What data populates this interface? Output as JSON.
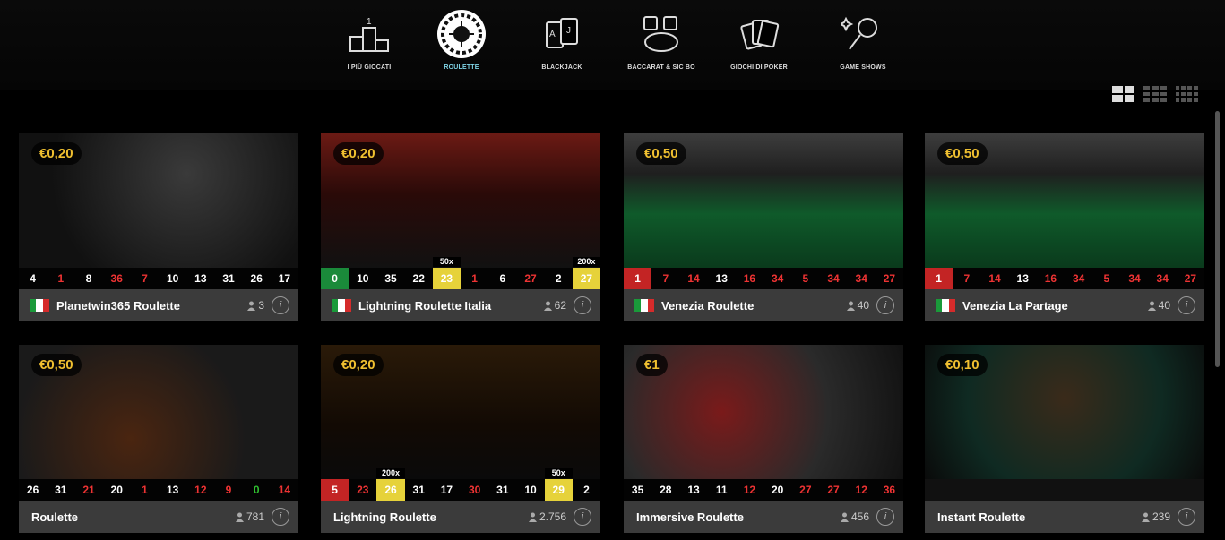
{
  "categories": [
    {
      "label": "I PIÙ GIOCATI",
      "icon": "podium-icon"
    },
    {
      "label": "ROULETTE",
      "icon": "roulette-wheel-icon",
      "active": true
    },
    {
      "label": "BLACKJACK",
      "icon": "cards-aj-icon"
    },
    {
      "label": "BACCARAT & SIC BO",
      "icon": "dice-cards-icon"
    },
    {
      "label": "GIOCHI DI POKER",
      "icon": "poker-cards-icon"
    },
    {
      "label": "GAME SHOWS",
      "icon": "microphone-icon"
    }
  ],
  "view_toggles": [
    "grid-2-icon",
    "grid-3-icon",
    "grid-4-icon"
  ],
  "tiles": [
    {
      "bet": "€0,20",
      "name": "Planetwin365 Roulette",
      "flag": true,
      "players": "3",
      "results": [
        [
          "4",
          "b"
        ],
        [
          "1",
          "r"
        ],
        [
          "8",
          "b"
        ],
        [
          "36",
          "r"
        ],
        [
          "7",
          "r"
        ],
        [
          "10",
          "b"
        ],
        [
          "13",
          "b"
        ],
        [
          "31",
          "b"
        ],
        [
          "26",
          "b"
        ],
        [
          "17",
          "b"
        ]
      ]
    },
    {
      "bet": "€0,20",
      "name": "Lightning Roulette Italia",
      "flag": true,
      "players": "62",
      "results": [
        [
          "0",
          "hlg"
        ],
        [
          "10",
          "b"
        ],
        [
          "35",
          "b"
        ],
        [
          "22",
          "b"
        ],
        [
          "23",
          "hl",
          "50x"
        ],
        [
          "1",
          "r"
        ],
        [
          "6",
          "b"
        ],
        [
          "27",
          "r"
        ],
        [
          "2",
          "b"
        ],
        [
          "27",
          "hl",
          "200x"
        ]
      ]
    },
    {
      "bet": "€0,50",
      "name": "Venezia Roulette",
      "flag": true,
      "players": "40",
      "results": [
        [
          "1",
          "hlr"
        ],
        [
          "7",
          "r"
        ],
        [
          "14",
          "r"
        ],
        [
          "13",
          "b"
        ],
        [
          "16",
          "r"
        ],
        [
          "34",
          "r"
        ],
        [
          "5",
          "r"
        ],
        [
          "34",
          "r"
        ],
        [
          "34",
          "r"
        ],
        [
          "27",
          "r"
        ]
      ]
    },
    {
      "bet": "€0,50",
      "name": "Venezia La Partage",
      "flag": true,
      "players": "40",
      "results": [
        [
          "1",
          "hlr"
        ],
        [
          "7",
          "r"
        ],
        [
          "14",
          "r"
        ],
        [
          "13",
          "b"
        ],
        [
          "16",
          "r"
        ],
        [
          "34",
          "r"
        ],
        [
          "5",
          "r"
        ],
        [
          "34",
          "r"
        ],
        [
          "34",
          "r"
        ],
        [
          "27",
          "r"
        ]
      ]
    },
    {
      "bet": "€0,50",
      "name": "Roulette",
      "flag": false,
      "players": "781",
      "results": [
        [
          "26",
          "b"
        ],
        [
          "31",
          "b"
        ],
        [
          "21",
          "r"
        ],
        [
          "20",
          "b"
        ],
        [
          "1",
          "r"
        ],
        [
          "13",
          "b"
        ],
        [
          "12",
          "r"
        ],
        [
          "9",
          "r"
        ],
        [
          "0",
          "g"
        ],
        [
          "14",
          "r"
        ]
      ]
    },
    {
      "bet": "€0,20",
      "name": "Lightning Roulette",
      "flag": false,
      "players": "2.756",
      "results": [
        [
          "5",
          "hlr"
        ],
        [
          "23",
          "r"
        ],
        [
          "26",
          "hl",
          "200x"
        ],
        [
          "31",
          "b"
        ],
        [
          "17",
          "b"
        ],
        [
          "30",
          "r"
        ],
        [
          "31",
          "b"
        ],
        [
          "10",
          "b"
        ],
        [
          "29",
          "hl",
          "50x"
        ],
        [
          "2",
          "b"
        ]
      ]
    },
    {
      "bet": "€1",
      "name": "Immersive Roulette",
      "flag": false,
      "players": "456",
      "results": [
        [
          "35",
          "b"
        ],
        [
          "28",
          "b"
        ],
        [
          "13",
          "b"
        ],
        [
          "11",
          "b"
        ],
        [
          "12",
          "r"
        ],
        [
          "20",
          "b"
        ],
        [
          "27",
          "r"
        ],
        [
          "27",
          "r"
        ],
        [
          "12",
          "r"
        ],
        [
          "36",
          "r"
        ]
      ]
    },
    {
      "bet": "€0,10",
      "name": "Instant Roulette",
      "flag": false,
      "players": "239",
      "results": []
    }
  ],
  "colors": {
    "accent": "#7fd4e6",
    "bet": "#f0c030",
    "bar": "#3b3b3b"
  }
}
